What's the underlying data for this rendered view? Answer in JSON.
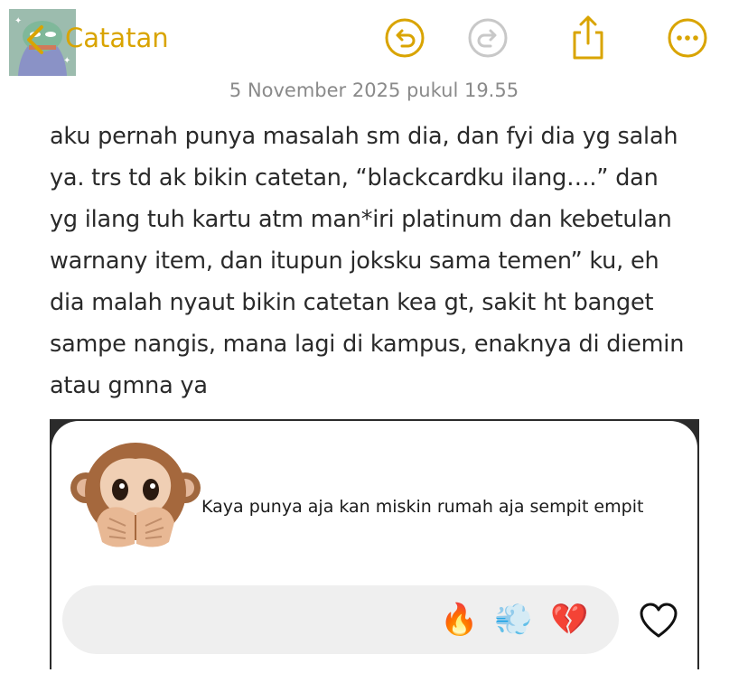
{
  "header": {
    "back_label": "Catatan",
    "accent_color": "#d9a400",
    "avatar_icon": "cartoon-avatar",
    "buttons": [
      {
        "name": "undo-button",
        "icon": "undo-icon",
        "enabled": true
      },
      {
        "name": "redo-button",
        "icon": "redo-icon",
        "enabled": false
      },
      {
        "name": "share-button",
        "icon": "share-icon",
        "enabled": true
      },
      {
        "name": "more-button",
        "icon": "more-icon",
        "enabled": true
      }
    ]
  },
  "note": {
    "date": "5 November 2025 pukul 19.55",
    "body": "aku pernah punya masalah sm dia, dan fyi dia yg salah\nya. trs td ak bikin catetan, “blackcardku ilang….” dan\nyg ilang tuh kartu atm man*iri platinum dan kebetulan\nwarnany item, dan itupun joksku sama temen” ku, eh\ndia malah nyaut bikin catetan kea gt, sakit ht banget\nsampe nangis, mana lagi di kampus, enaknya di diemin\natau gmna ya"
  },
  "embedded_screenshot": {
    "note_emoji": "🙊",
    "note_text": "Kaya punya aja kan miskin rumah aja sempit empit",
    "reactions": [
      "🔥",
      "💨",
      "💔"
    ],
    "like_icon": "heart-outline-icon"
  }
}
